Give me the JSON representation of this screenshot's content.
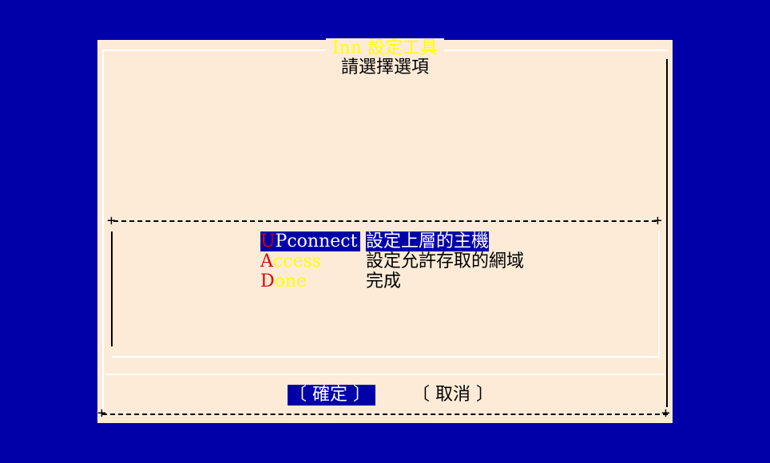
{
  "dialog": {
    "title": "Inn 設定工具",
    "prompt": "請選擇選項"
  },
  "menu": {
    "items": [
      {
        "hotkey": "U",
        "tag_rest": "Pconnect",
        "description": "設定上層的主機",
        "selected": true
      },
      {
        "hotkey": "A",
        "tag_rest": "ccess",
        "description": "設定允許存取的網域",
        "selected": false
      },
      {
        "hotkey": "D",
        "tag_rest": "one",
        "description": "完成",
        "selected": false
      }
    ]
  },
  "buttons": {
    "ok_label": "〔 確定 〕",
    "cancel_label": "〔 取消 〕"
  },
  "colors": {
    "screen_background": "#0000a8",
    "dialog_background": "#fdebd8",
    "title_text": "#ffff00",
    "hotkey": "#e00000",
    "selection": "#0000a8"
  }
}
